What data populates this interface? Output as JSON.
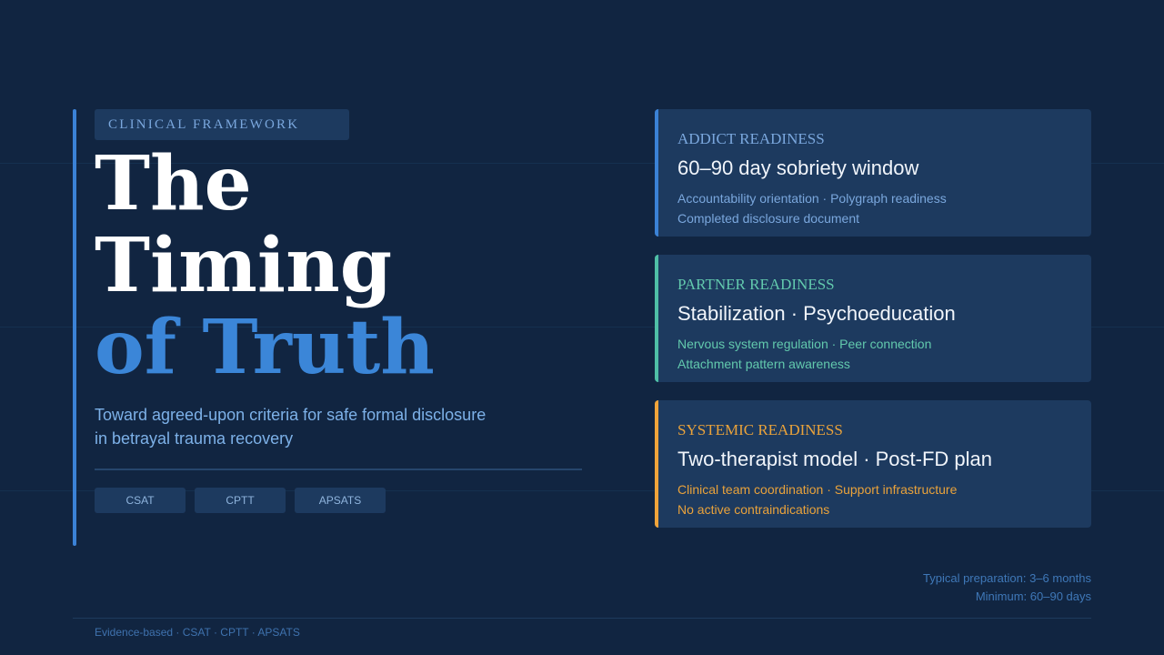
{
  "badge": "CLINICAL FRAMEWORK",
  "title": {
    "line1": "The",
    "line2": "Timing",
    "line3": "of Truth"
  },
  "subtitle": {
    "line1": "Toward agreed-upon criteria for safe formal disclosure",
    "line2": "in betrayal trauma recovery"
  },
  "tags": [
    "CSAT",
    "CPTT",
    "APSATS"
  ],
  "cards": [
    {
      "eyebrow": "ADDICT READINESS",
      "title": "60–90 day sobriety window",
      "detail1": "Accountability orientation · Polygraph readiness",
      "detail2": "Completed disclosure document",
      "color": "#3b82d6",
      "text_color": "#7aa7dd"
    },
    {
      "eyebrow": "PARTNER READINESS",
      "title": "Stabilization · Psychoeducation",
      "detail1": "Nervous system regulation · Peer connection",
      "detail2": "Attachment pattern awareness",
      "color": "#4fbfa6",
      "text_color": "#62c9ad"
    },
    {
      "eyebrow": "SYSTEMIC READINESS",
      "title": "Two-therapist model · Post-FD plan",
      "detail1": "Clinical team coordination · Support infrastructure",
      "detail2": "No active contraindications",
      "color": "#f0a43a",
      "text_color": "#e9a23b"
    }
  ],
  "prep": {
    "line1": "Typical preparation: 3–6 months",
    "line2": "Minimum: 60–90 days"
  },
  "footer": "Evidence-based · CSAT · CPTT · APSATS"
}
